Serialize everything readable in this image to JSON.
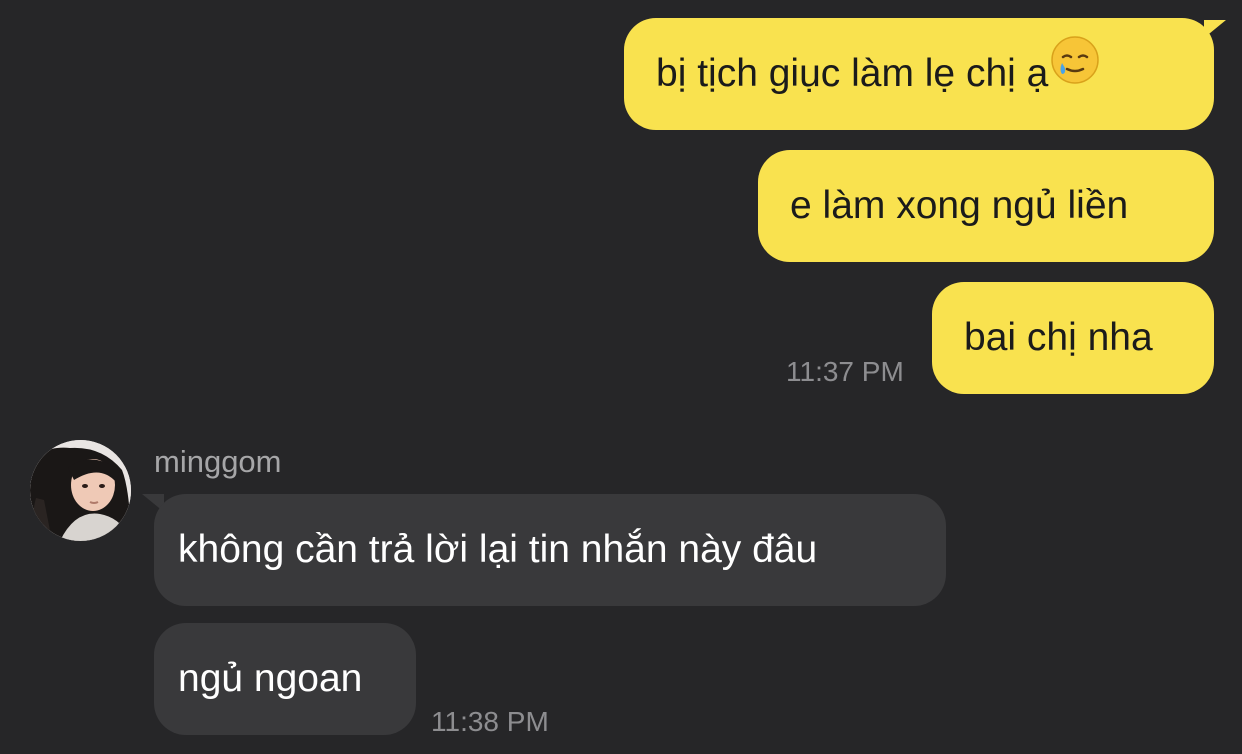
{
  "messages_out": [
    {
      "text": "bị tịch giục làm lẹ chị ạ",
      "emoji": "sad-relieved-face-emoji"
    },
    {
      "text": "e làm xong ngủ liền"
    },
    {
      "text": "bai chị nha"
    }
  ],
  "time_out": "11:37 PM",
  "sender": {
    "name": "minggom"
  },
  "messages_in": [
    {
      "text": "không cần trả lời lại tin nhắn này đâu"
    },
    {
      "text": "ngủ ngoan"
    }
  ],
  "time_in": "11:38 PM",
  "colors": {
    "background": "#262628",
    "outgoing_bubble": "#f9e24f",
    "incoming_bubble": "#39393b",
    "timestamp": "#8d8d90"
  }
}
